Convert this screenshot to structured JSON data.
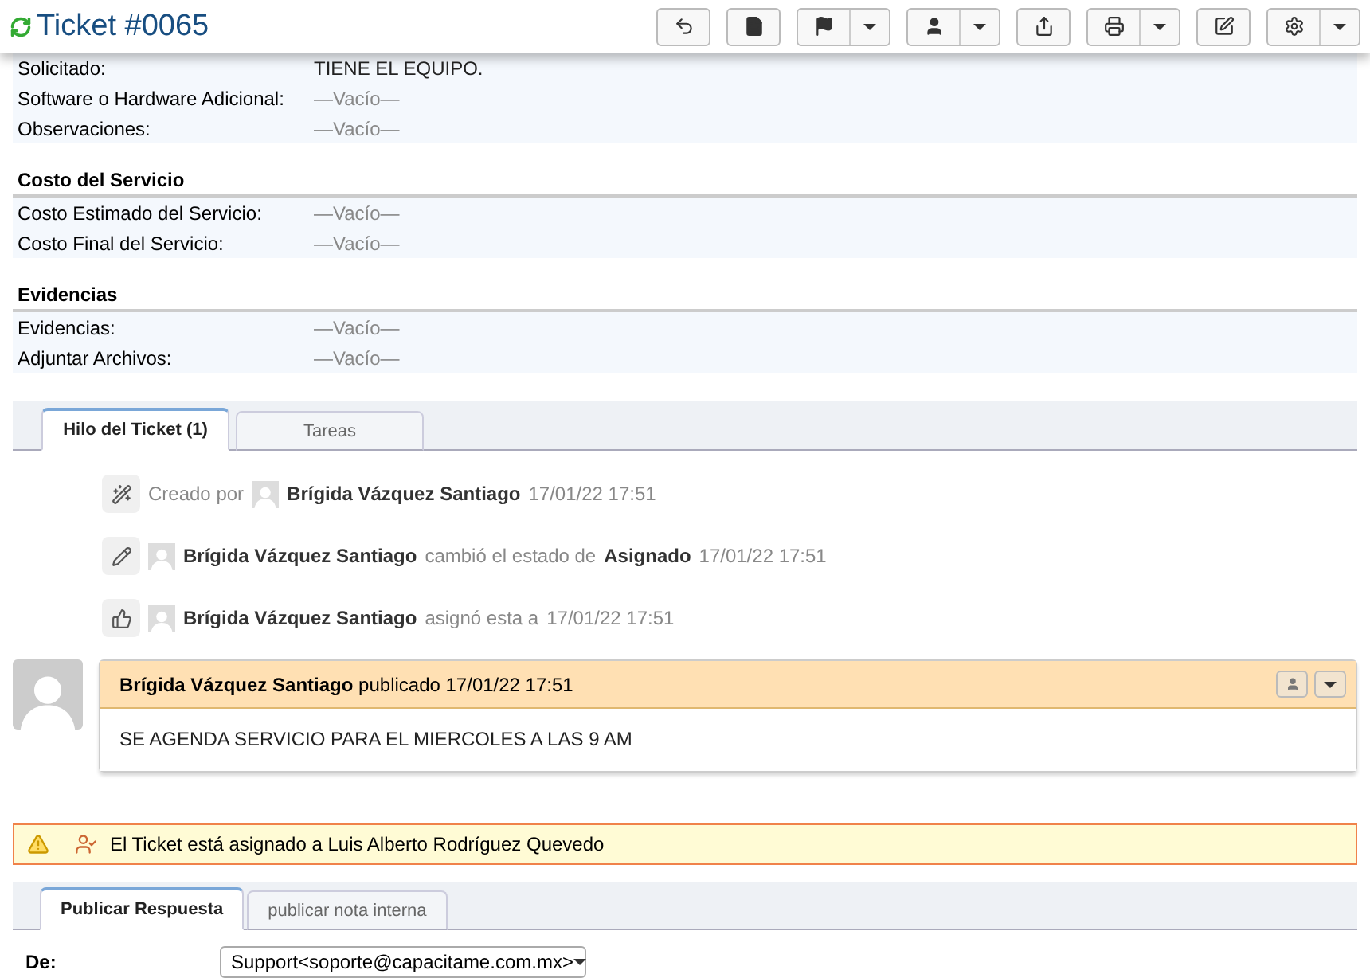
{
  "header": {
    "title": "Ticket #0065",
    "toolbar": [
      {
        "kind": "reply",
        "dropdown": false
      },
      {
        "kind": "file",
        "dropdown": false
      },
      {
        "kind": "flag",
        "dropdown": true
      },
      {
        "kind": "user",
        "dropdown": true
      },
      {
        "kind": "share",
        "dropdown": false
      },
      {
        "kind": "print",
        "dropdown": true
      },
      {
        "kind": "edit",
        "dropdown": false
      },
      {
        "kind": "gear",
        "dropdown": true
      }
    ]
  },
  "sections": [
    {
      "rows": [
        {
          "label": "Solicitado:",
          "value": "TIENE EL EQUIPO.",
          "empty": false
        },
        {
          "label": "Software o Hardware Adicional:",
          "value": "—Vacío—",
          "empty": true
        },
        {
          "label": "Observaciones:",
          "value": "—Vacío—",
          "empty": true
        }
      ]
    },
    {
      "title": "Costo del Servicio",
      "rows": [
        {
          "label": "Costo Estimado del Servicio:",
          "value": "—Vacío—",
          "empty": true
        },
        {
          "label": "Costo Final del Servicio:",
          "value": "—Vacío—",
          "empty": true
        }
      ]
    },
    {
      "title": "Evidencias",
      "rows": [
        {
          "label": "Evidencias:",
          "value": "—Vacío—",
          "empty": true
        },
        {
          "label": "Adjuntar Archivos:",
          "value": "—Vacío—",
          "empty": true
        }
      ]
    }
  ],
  "thread_tabs": [
    {
      "label": "Hilo del Ticket (1)",
      "selected": true
    },
    {
      "label": "Tareas",
      "selected": false
    }
  ],
  "events": [
    {
      "kind": "created",
      "lead": "Creado por",
      "user": "Brígida Vázquez Santiago",
      "date": "17/01/22 17:51"
    },
    {
      "kind": "edited",
      "user": "Brígida Vázquez Santiago",
      "action": "cambió el estado de",
      "target": "Asignado",
      "date": "17/01/22 17:51"
    },
    {
      "kind": "assigned",
      "user": "Brígida Vázquez Santiago",
      "action": "asignó esta a",
      "date": "17/01/22 17:51"
    }
  ],
  "message": {
    "author": "Brígida Vázquez Santiago",
    "meta": "publicado 17/01/22 17:51",
    "body": "SE AGENDA SERVICIO PARA EL MIERCOLES A LAS 9 AM"
  },
  "alert": {
    "text": "El Ticket está asignado a Luis Alberto Rodríguez Quevedo"
  },
  "reply_tabs": [
    {
      "label": "Publicar Respuesta",
      "selected": true
    },
    {
      "label": "publicar nota interna",
      "selected": false
    }
  ],
  "reply_form": {
    "from_label": "De:",
    "from_value": "Support<soporte@capacitame.com.mx>"
  }
}
